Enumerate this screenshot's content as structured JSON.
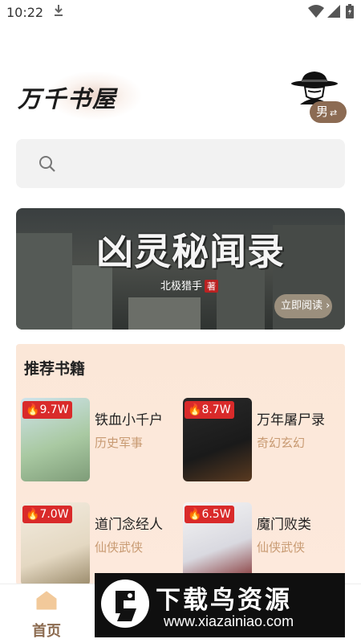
{
  "status_bar": {
    "time": "10:22"
  },
  "header": {
    "logo_text": "万千书屋",
    "gender_label": "男",
    "gender_swap": "⇄"
  },
  "search": {
    "placeholder": ""
  },
  "banner": {
    "title": "凶灵秘闻录",
    "author": "北极猎手",
    "author_tag": "著",
    "read_button": "立即阅读 ›"
  },
  "recommended": {
    "heading": "推荐书籍",
    "books": [
      {
        "hot": "9.7W",
        "title": "铁血小千户",
        "genre": "历史军事"
      },
      {
        "hot": "8.7W",
        "title": "万年屠尸录",
        "genre": "奇幻玄幻"
      },
      {
        "hot": "7.0W",
        "title": "道门念经人",
        "genre": "仙侠武侠"
      },
      {
        "hot": "6.5W",
        "title": "魔门败类",
        "genre": "仙侠武侠"
      }
    ]
  },
  "nav": {
    "home_label": "首页"
  },
  "watermark": {
    "name": "下载鸟资源",
    "url": "www.xiazainiao.com"
  }
}
